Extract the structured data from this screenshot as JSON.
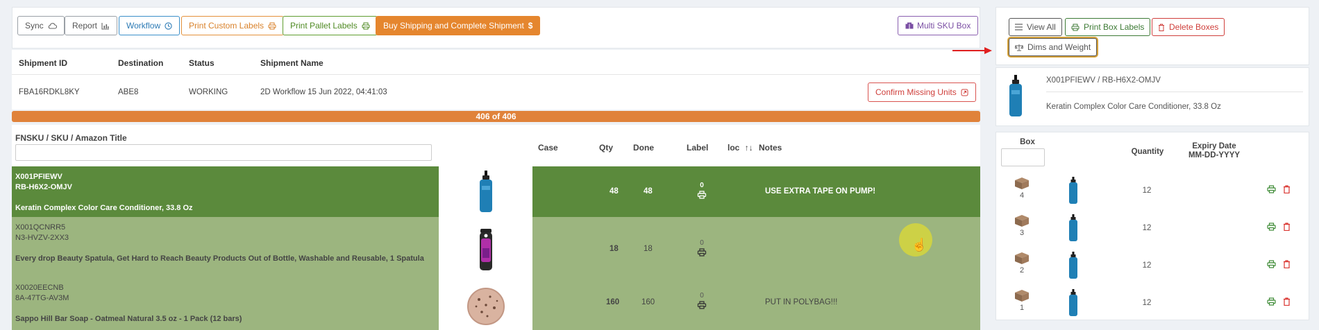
{
  "toolbar": {
    "sync": "Sync",
    "report": "Report",
    "workflow": "Workflow",
    "print_custom": "Print Custom Labels",
    "print_pallet": "Print Pallet Labels",
    "buy_shipping": "Buy Shipping and Complete Shipment",
    "multi_sku": "Multi SKU Box"
  },
  "shipment": {
    "headers": [
      "Shipment ID",
      "Destination",
      "Status",
      "Shipment Name"
    ],
    "id": "FBA16RDKL8KY",
    "destination": "ABE8",
    "status": "WORKING",
    "name": "2D Workflow 15 Jun 2022, 04:41:03",
    "confirm_missing": "Confirm Missing Units"
  },
  "progress": {
    "text": "406 of 406",
    "fraction": 1.0
  },
  "table": {
    "headers": {
      "fnsku": "FNSKU / SKU / Amazon Title",
      "case": "Case",
      "qty": "Qty",
      "done": "Done",
      "label": "Label",
      "loc": "loc",
      "notes": "Notes"
    },
    "filter_value": "",
    "rows": [
      {
        "fnsku": "X001PFIEWV",
        "sku": "RB-H6X2-OMJV",
        "title": "Keratin Complex Color Care Conditioner, 33.8 Oz",
        "qty": "48",
        "done": "48",
        "label_count": "0",
        "notes": "USE EXTRA TAPE ON PUMP!"
      },
      {
        "fnsku": "X001QCNRR5",
        "sku": "N3-HVZV-2XX3",
        "title": "Every drop Beauty Spatula, Get Hard to Reach Beauty Products Out of Bottle, Washable and Reusable, 1 Spatula",
        "qty": "18",
        "done": "18",
        "label_count": "0",
        "notes": ""
      },
      {
        "fnsku": "X0020EECNB",
        "sku": "8A-47TG-AV3M",
        "title": "Sappo Hill Bar Soap - Oatmeal Natural 3.5 oz - 1 Pack (12 bars)",
        "qty": "160",
        "done": "160",
        "label_count": "0",
        "notes": "PUT IN POLYBAG!!!"
      }
    ]
  },
  "right": {
    "view_all": "View All",
    "print_box_labels": "Print Box Labels",
    "delete_boxes": "Delete Boxes",
    "dims_weight": "Dims and Weight",
    "product": {
      "sku_line": "X001PFIEWV / RB-H6X2-OMJV",
      "title": "Keratin Complex Color Care Conditioner, 33.8 Oz"
    },
    "box_headers": {
      "box": "Box",
      "quantity": "Quantity",
      "expiry_line1": "Expiry Date",
      "expiry_line2": "MM-DD-YYYY"
    },
    "box_filter": "",
    "boxes": [
      {
        "number": "4",
        "quantity": "12"
      },
      {
        "number": "3",
        "quantity": "12"
      },
      {
        "number": "2",
        "quantity": "12"
      },
      {
        "number": "1",
        "quantity": "12"
      }
    ]
  },
  "colors": {
    "accent_orange": "#e5862e",
    "row_highlight": "#5b8a3c",
    "row_normal": "#9cb57f",
    "arrow": "#e02020"
  },
  "icons": [
    "cloud-sync-icon",
    "chart-icon",
    "clock-icon",
    "printer-icon",
    "dollar-icon",
    "boxes-icon",
    "external-link-icon",
    "sort-icon",
    "list-icon",
    "trash-icon",
    "scale-icon",
    "box-icon",
    "hand-cursor-icon",
    "arrow-right-icon"
  ]
}
